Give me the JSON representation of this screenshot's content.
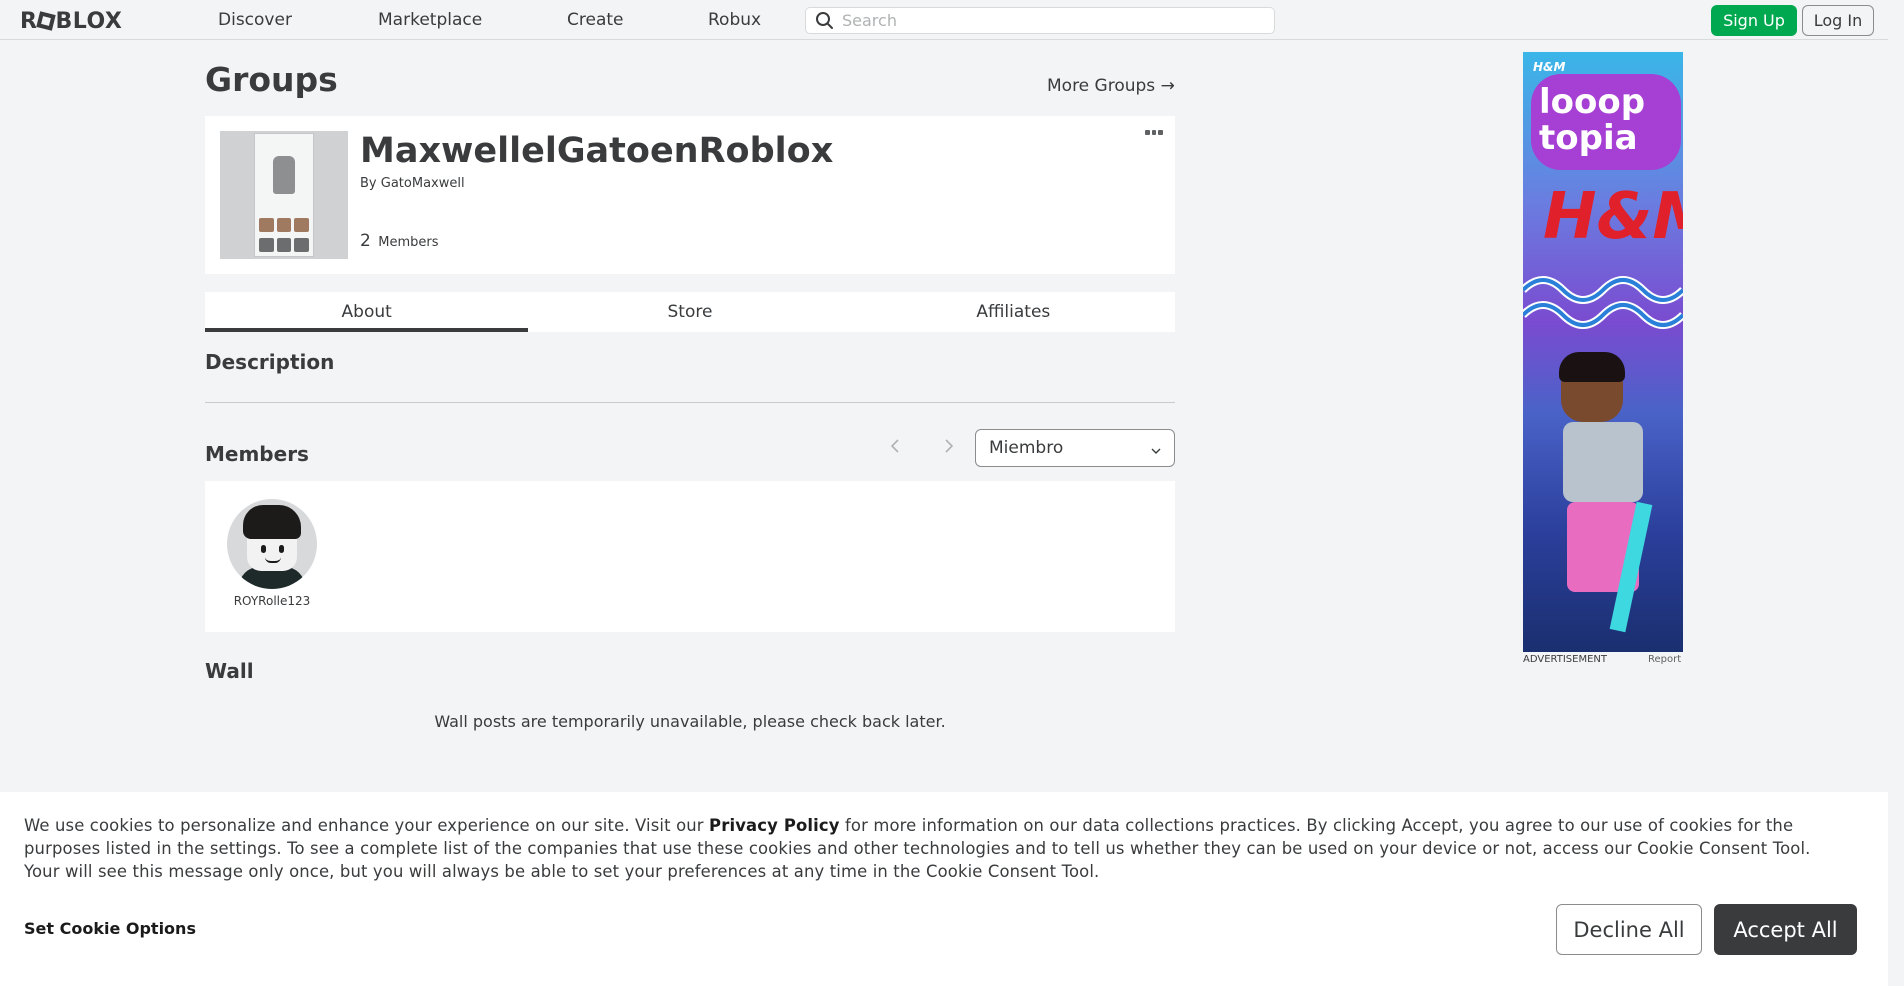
{
  "nav": {
    "logo": "ROBLOX",
    "links": [
      "Discover",
      "Marketplace",
      "Create",
      "Robux"
    ],
    "search_placeholder": "Search",
    "signup": "Sign Up",
    "login": "Log In"
  },
  "page": {
    "title": "Groups",
    "more_groups": "More Groups →"
  },
  "group": {
    "name": "MaxwellelGatoenRoblox",
    "by_label": "By",
    "owner": "GatoMaxwell",
    "member_count": "2",
    "member_label": "Members"
  },
  "tabs": [
    {
      "label": "About",
      "active": true
    },
    {
      "label": "Store",
      "active": false
    },
    {
      "label": "Affiliates",
      "active": false
    }
  ],
  "sections": {
    "description": "Description",
    "members": "Members",
    "wall": "Wall"
  },
  "members": {
    "role_select": "Miembro",
    "list": [
      {
        "name": "ROYRolle123"
      }
    ]
  },
  "wall": {
    "message": "Wall posts are temporarily unavailable, please check back later."
  },
  "ad": {
    "brand_small": "H&M",
    "title": "looop topia",
    "brand": "H&M",
    "label": "ADVERTISEMENT",
    "report": "Report"
  },
  "cookie": {
    "text_before": "We use cookies to personalize and enhance your experience on our site. Visit our ",
    "link": "Privacy Policy",
    "text_after": " for more information on our data collections practices. By clicking Accept, you agree to our use of cookies for the purposes listed in the settings. To see a complete list of the companies that use these cookies and other technologies and to tell us whether they can be used on your device or not, access our Cookie Consent Tool. Your will see this message only once, but you will always be able to set your preferences at any time in the Cookie Consent Tool.",
    "set_options": "Set Cookie Options",
    "decline": "Decline All",
    "accept": "Accept All"
  },
  "colors": {
    "signup": "#00a94f",
    "accept": "#393b3d",
    "text": "#393b3d"
  }
}
